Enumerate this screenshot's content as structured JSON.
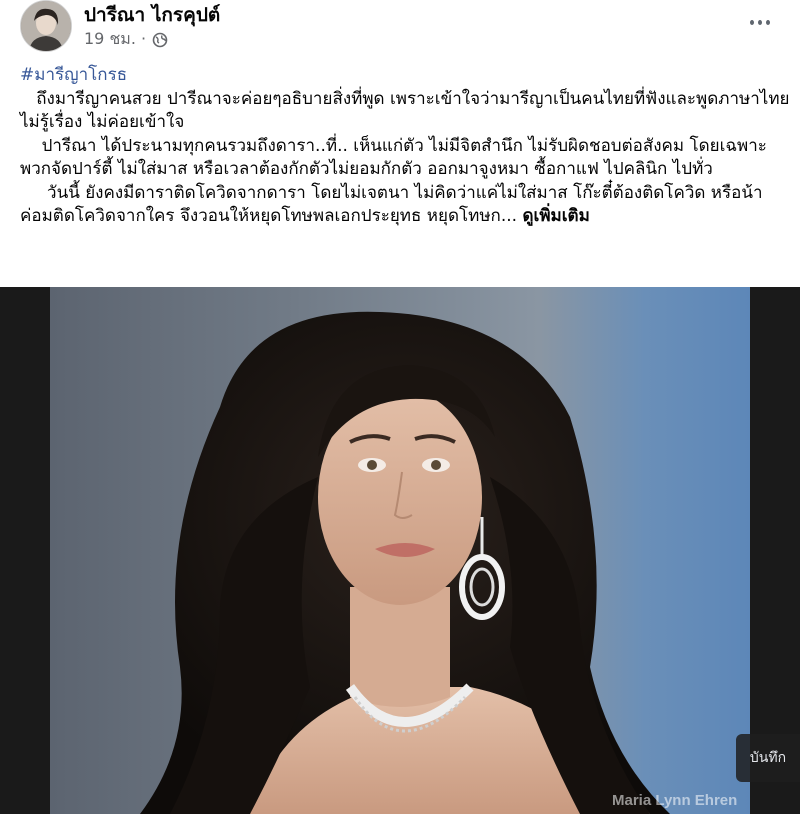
{
  "post": {
    "author": "ปารีณา ไกรคุปต์",
    "timestamp": "19 ชม. ·",
    "privacy_icon": "globe-icon",
    "hashtag": "#มารีญาโกรธ",
    "paragraphs": [
      "   ถึงมารีญาคนสวย ปารีณาจะค่อยๆอธิบายสิ่งที่พูด เพราะเข้าใจว่ามารีญาเป็นคนไทยที่ฟังและพูดภาษาไทยไม่รู้เรื่อง ไม่ค่อยเข้าใจ",
      "    ปารีณา ได้ประนามทุกคนรวมถึงดารา..ที่.. เห็นแก่ตัว ไม่มีจิตสำนึก ไม่รับผิดชอบต่อสังคม โดยเฉพาะพวกจัดปาร์ตี้ ไม่ใส่มาส หรือเวลาต้องกักตัวไม่ยอมกักตัว ออกมาจูงหมา ซื้อกาแฟ ไปคลินิก ไปทั่ว",
      "     วันนี้ ยังคงมีดาราติดโควิดจากดารา โดยไม่เจตนา ไม่คิดว่าแค่ไม่ใส่มาส โก๊ะตี๋ต้องติดโควิด หรือน้าค่อมติดโควิดจากใคร จึงวอนให้หยุดโทษพลเอกประยุทธ หยุดโทษก... "
    ],
    "see_more": "ดูเพิ่มเติม"
  },
  "photo": {
    "watermark": "Maria Lynn Ehren",
    "save_label": "บันทึก"
  },
  "colors": {
    "hashtag": "#385898",
    "meta": "#65676b",
    "text": "#050505"
  }
}
